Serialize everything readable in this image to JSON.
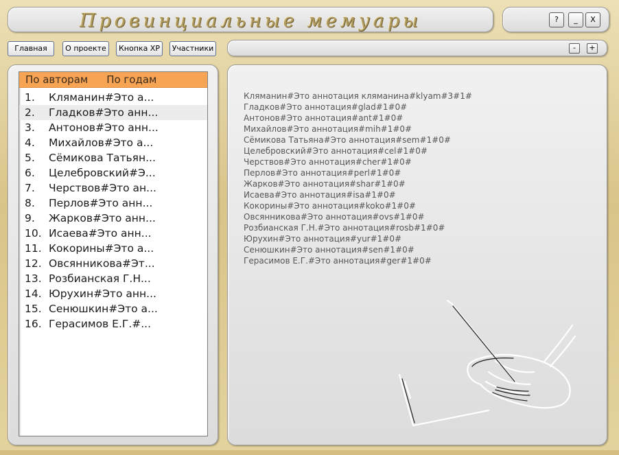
{
  "app": {
    "title": "Провинциальные мемуары"
  },
  "window_controls": {
    "help": "?",
    "minimize": "_",
    "close": "X"
  },
  "nav": {
    "home": "Главная",
    "about": "О проекте",
    "xp_button": "Кнопка XP",
    "participants": "Участники"
  },
  "zoom": {
    "minus": "-",
    "plus": "+"
  },
  "list": {
    "tabs": {
      "by_authors": "По авторам",
      "by_years": "По годам"
    },
    "items": [
      {
        "num": "1.",
        "text": "Кляманин#Это а..."
      },
      {
        "num": "2.",
        "text": "Гладков#Это анн..."
      },
      {
        "num": "3.",
        "text": "Антонов#Это анн..."
      },
      {
        "num": "4.",
        "text": "Михайлов#Это а..."
      },
      {
        "num": "5.",
        "text": "Сёмикова Татьян..."
      },
      {
        "num": "6.",
        "text": "Целебровский#Э..."
      },
      {
        "num": "7.",
        "text": "Черствов#Это ан..."
      },
      {
        "num": "8.",
        "text": "Перлов#Это анн..."
      },
      {
        "num": "9.",
        "text": "Жарков#Это анн..."
      },
      {
        "num": "10.",
        "text": "Исаева#Это анн..."
      },
      {
        "num": "11.",
        "text": "Кокорины#Это а..."
      },
      {
        "num": "12.",
        "text": "Овсянникова#Эт..."
      },
      {
        "num": "13.",
        "text": "Розбианская Г.Н..."
      },
      {
        "num": "14.",
        "text": "Юрухин#Это анн..."
      },
      {
        "num": "15.",
        "text": "Сенюшкин#Это а..."
      },
      {
        "num": "16.",
        "text": "Герасимов Е.Г.#..."
      }
    ]
  },
  "annotations": [
    "Кляманин#Это аннотация кляманина#klyam#3#1#",
    "Гладков#Это аннотация#glad#1#0#",
    "Антонов#Это аннотация#ant#1#0#",
    "Михайлов#Это аннотация#mih#1#0#",
    "Сёмикова Татьяна#Это аннотация#sem#1#0#",
    "Целебровский#Это аннотация#cel#1#0#",
    "Черствов#Это аннотация#cher#1#0#",
    "Перлов#Это аннотация#perl#1#0#",
    "Жарков#Это аннотация#shar#1#0#",
    "Исаева#Это аннотация#isa#1#0#",
    "Кокорины#Это аннотация#koko#1#0#",
    "Овсянникова#Это аннотация#ovs#1#0#",
    "Розбианская Г.Н.#Это аннотация#rosb#1#0#",
    "Юрухин#Это аннотация#yur#1#0#",
    "Сенюшкин#Это аннотация#sen#1#0#",
    "Герасимов Е.Г.#Это аннотация#ger#1#0#"
  ],
  "colors": {
    "accent_header": "#f7a455",
    "title_gold": "#b09a5e",
    "annotation_text": "#555555"
  },
  "icons": {
    "drawing": "writing-hand-sketch-icon"
  }
}
